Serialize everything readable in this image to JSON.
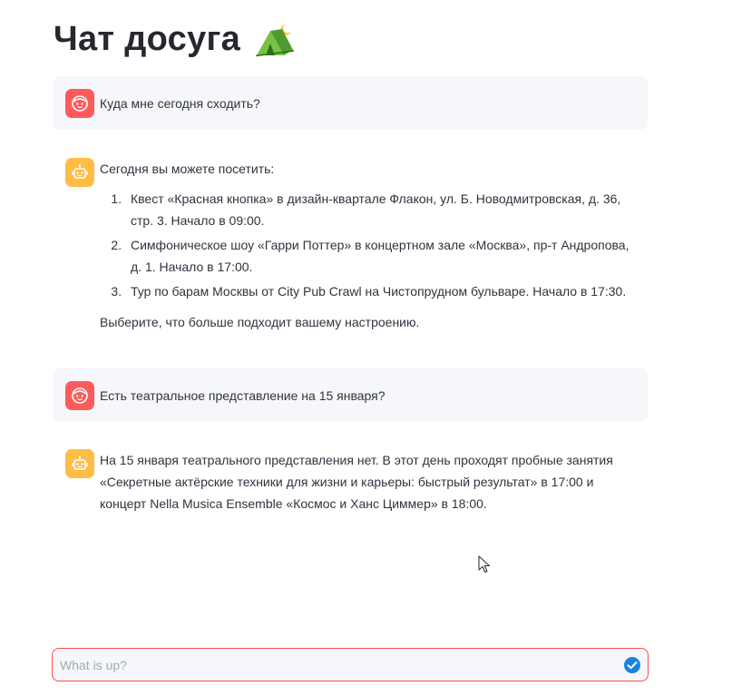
{
  "page": {
    "title": "Чат досуга"
  },
  "messages": [
    {
      "role": "user",
      "text": "Куда мне сегодня сходить?"
    },
    {
      "role": "assistant",
      "intro": "Сегодня вы можете посетить:",
      "items": [
        "Квест «Красная кнопка» в дизайн-квартале Флакон, ул. Б. Новодмитровская, д. 36, стр. 3. Начало в 09:00.",
        "Симфоническое шоу «Гарри Поттер» в концертном зале «Москва», пр-т Андропова, д. 1. Начало в 17:00.",
        "Тур по барам Москвы от City Pub Crawl на Чистопрудном бульваре. Начало в 17:30."
      ],
      "closing": "Выберите, что больше подходит вашему настроению."
    },
    {
      "role": "user",
      "text": "Есть театральное представление на 15 января?"
    },
    {
      "role": "assistant",
      "text": "На 15 января театрального представления нет. В этот день проходят пробные занятия «Секретные актёрские техники для жизни и карьеры: быстрый результат» в 17:00 и концерт Nella Musica Ensemble «Космос и Ханс Циммер» в 18:00."
    }
  ],
  "chat_input": {
    "placeholder": "What is up?",
    "value": ""
  },
  "icons": {
    "title_icon": "tent-icon",
    "user_avatar": "user-face-icon",
    "assistant_avatar": "robot-face-icon",
    "send": "send-icon",
    "cursor": "mouse-pointer-icon"
  },
  "colors": {
    "user_avatar": "#ff4b4b",
    "assistant_avatar": "#ffbd45",
    "user_bubble": "#f6f7fa",
    "input_border": "#ff4b4b",
    "send_button": "#1c83e1"
  }
}
